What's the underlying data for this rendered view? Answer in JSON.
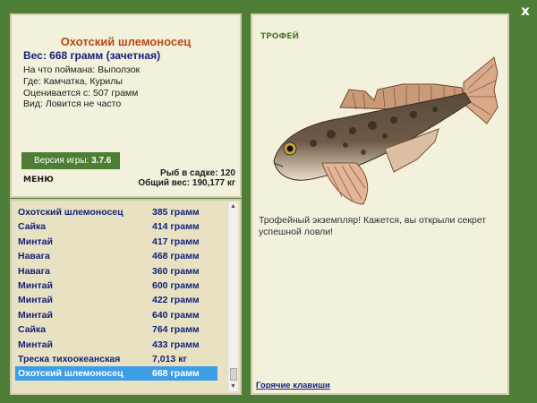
{
  "window": {
    "close_label": "x"
  },
  "info": {
    "fish_name": "Охотский шлемоносец",
    "weight_line": "Вес: 668 грамм (зачетная)",
    "bait_line": "На что поймана: Выползок",
    "location_line": "Где: Камчатка, Курилы",
    "value_line": "Оценивается с: 507 грамм",
    "kind_line": "Вид: Ловится не часто"
  },
  "version": {
    "label": "Версия игры:",
    "value": "3.7.6"
  },
  "menu": {
    "label": "МЕНЮ"
  },
  "stats": {
    "fish_count": "Рыб в садке: 120",
    "total_weight": "Общий вес: 190,177 кг"
  },
  "catch_list": [
    {
      "name": "Охотский шлемоносец",
      "weight": "385 грамм"
    },
    {
      "name": "Сайка",
      "weight": "414 грамм"
    },
    {
      "name": "Минтай",
      "weight": "417 грамм"
    },
    {
      "name": "Навага",
      "weight": "468 грамм"
    },
    {
      "name": "Навага",
      "weight": "360 грамм"
    },
    {
      "name": "Минтай",
      "weight": "600 грамм"
    },
    {
      "name": "Минтай",
      "weight": "422 грамм"
    },
    {
      "name": "Минтай",
      "weight": "640 грамм"
    },
    {
      "name": "Сайка",
      "weight": "764 грамм"
    },
    {
      "name": "Минтай",
      "weight": "433 грамм"
    },
    {
      "name": "Треска тихоокеанская",
      "weight": "7,013 кг"
    },
    {
      "name": "Охотский шлемоносец",
      "weight": "668 грамм"
    }
  ],
  "selected_index": 11,
  "trophy": {
    "label": "ТРОФЕЙ",
    "message": "Трофейный экземпляр! Кажется, вы открыли секрет успешной ловли!",
    "fish_icon": "sculpin-fish-image"
  },
  "hotkeys": {
    "label": "Горячие клавиши"
  },
  "colors": {
    "background": "#4e7d35",
    "panel": "#f3f0dc",
    "list_bg": "#e8e2c2",
    "title": "#b8481a",
    "text_blue": "#14207a",
    "selection": "#3d9ee8"
  }
}
